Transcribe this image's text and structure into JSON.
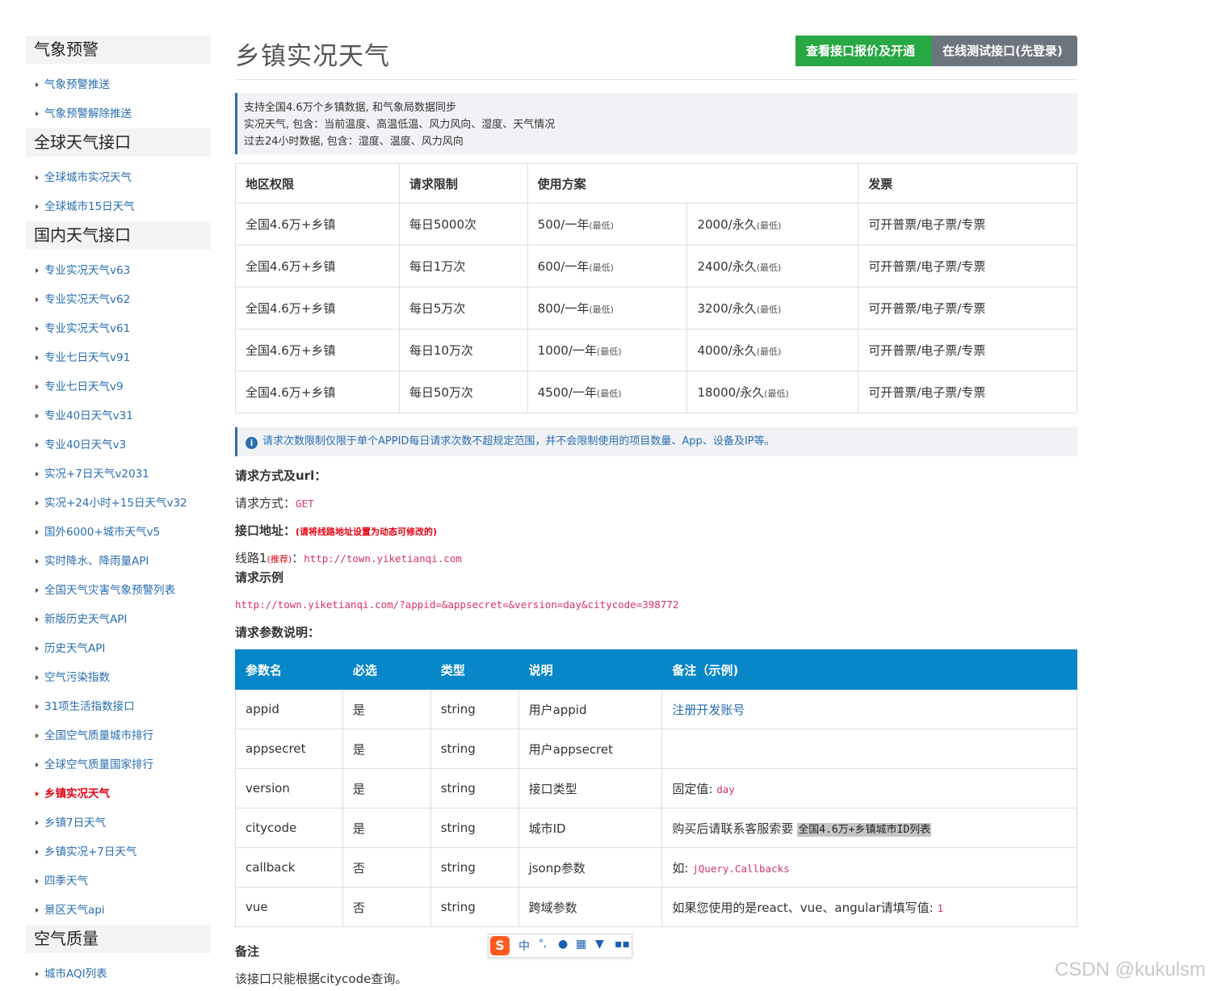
{
  "sidebar": {
    "sec1": "气象预警",
    "sec1_items": [
      "气象预警推送",
      "气象预警解除推送"
    ],
    "sec2": "全球天气接口",
    "sec2_items": [
      "全球城市实况天气",
      "全球城市15日天气"
    ],
    "sec3": "国内天气接口",
    "sec3_items": [
      "专业实况天气v63",
      "专业实况天气v62",
      "专业实况天气v61",
      "专业七日天气v91",
      "专业七日天气v9",
      "专业40日天气v31",
      "专业40日天气v3",
      "实况+7日天气v2031",
      "实况+24小时+15日天气v32",
      "国外6000+城市天气v5",
      "实时降水、降雨量API",
      "全国天气灾害气象预警列表",
      "新版历史天气API",
      "历史天气API",
      "空气污染指数",
      "31项生活指数接口",
      "全国空气质量城市排行",
      "全球空气质量国家排行",
      "乡镇实况天气",
      "乡镇7日天气",
      "乡镇实况+7日天气",
      "四季天气",
      "景区天气api"
    ],
    "active_index": 18,
    "sec4": "空气质量",
    "sec4_items": [
      "城市AQI列表"
    ]
  },
  "header": {
    "title": "乡镇实况天气",
    "btn_price": "查看接口报价及开通",
    "btn_test": "在线测试接口(先登录)"
  },
  "intro": [
    "支持全国4.6万个乡镇数据, 和气象局数据同步",
    "实况天气, 包含：当前温度、高温低温、风力风向、湿度、天气情况",
    "过去24小时数据, 包含：湿度、温度、风力风向"
  ],
  "price_table": {
    "headers": [
      "地区权限",
      "请求限制",
      "使用方案",
      "发票"
    ],
    "unit_year": "/一年",
    "unit_forever": "/永久",
    "min_tag": "(最低)",
    "rows": [
      {
        "region": "全国4.6万+乡镇",
        "limit": "每日5000次",
        "year": "500",
        "forever": "2000",
        "invoice": "可开普票/电子票/专票"
      },
      {
        "region": "全国4.6万+乡镇",
        "limit": "每日1万次",
        "year": "600",
        "forever": "2400",
        "invoice": "可开普票/电子票/专票"
      },
      {
        "region": "全国4.6万+乡镇",
        "limit": "每日5万次",
        "year": "800",
        "forever": "3200",
        "invoice": "可开普票/电子票/专票"
      },
      {
        "region": "全国4.6万+乡镇",
        "limit": "每日10万次",
        "year": "1000",
        "forever": "4000",
        "invoice": "可开普票/电子票/专票"
      },
      {
        "region": "全国4.6万+乡镇",
        "limit": "每日50万次",
        "year": "4500",
        "forever": "18000",
        "invoice": "可开普票/电子票/专票"
      }
    ]
  },
  "notice": "请求次数限制仅限于单个APPID每日请求次数不超规定范围，并不会限制使用的项目数量、App、设备及IP等。",
  "request": {
    "heading": "请求方式及url：",
    "method_label": "请求方式：",
    "method": "GET",
    "addr_label": "接口地址：",
    "addr_note": "(请将线路地址设置为动态可修改的)",
    "line1_label": "线路1",
    "line1_tag": "(推荐)",
    "line1_colon": "：",
    "line1_url": "http://town.yiketianqi.com",
    "example_heading": "请求示例",
    "example_url": "http://town.yiketianqi.com/?appid=&appsecret=&version=day&citycode=398772",
    "params_heading": "请求参数说明："
  },
  "params_table": {
    "headers": [
      "参数名",
      "必选",
      "类型",
      "说明",
      "备注（示例)"
    ],
    "rows": [
      {
        "name": "appid",
        "req": "是",
        "type": "string",
        "desc": "用户appid",
        "note_link": "注册开发账号"
      },
      {
        "name": "appsecret",
        "req": "是",
        "type": "string",
        "desc": "用户appsecret"
      },
      {
        "name": "version",
        "req": "是",
        "type": "string",
        "desc": "接口类型",
        "note_text": "固定值: ",
        "note_code": "day"
      },
      {
        "name": "citycode",
        "req": "是",
        "type": "string",
        "desc": "城市ID",
        "note_text": "购买后请联系客服索要 ",
        "note_hl": "全国4.6万+乡镇城市ID列表"
      },
      {
        "name": "callback",
        "req": "否",
        "type": "string",
        "desc": "jsonp参数",
        "note_text": "如: ",
        "note_code": "jQuery.Callbacks"
      },
      {
        "name": "vue",
        "req": "否",
        "type": "string",
        "desc": "跨域参数",
        "note_text": "如果您使用的是react、vue、angular请填写值: ",
        "note_code": "1"
      }
    ]
  },
  "remark": {
    "heading": "备注",
    "text": "该接口只能根据citycode查询。"
  },
  "ime": {
    "logo": "S",
    "lang": "中"
  },
  "watermark": "CSDN @kukulsm"
}
